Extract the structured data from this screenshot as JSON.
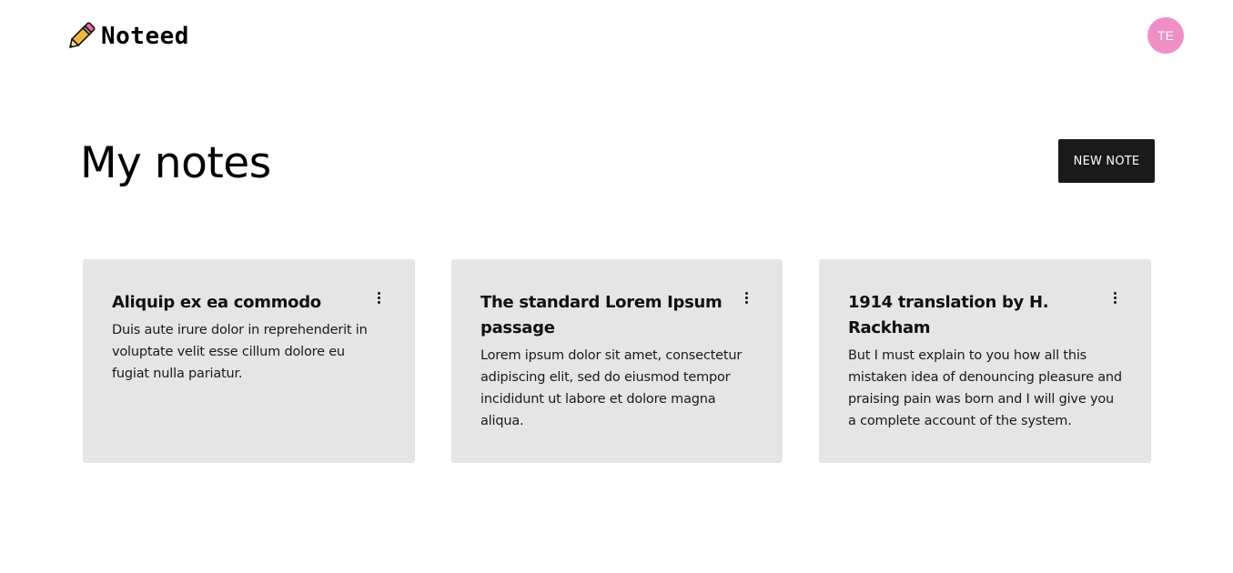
{
  "app": {
    "brand_name": "Noteed",
    "brand_icon": "pencil-icon"
  },
  "user": {
    "initials": "TE",
    "avatar_color": "#f08fc6"
  },
  "main": {
    "title": "My notes",
    "new_note_label": "NEW NOTE"
  },
  "notes": [
    {
      "title": "Aliquip ex ea commodo",
      "body": "Duis aute irure dolor in reprehenderit in voluptate velit esse cillum dolore eu fugiat nulla pariatur.",
      "menu_icon": "more-vertical-icon"
    },
    {
      "title": "The standard Lorem Ipsum passage",
      "body": "Lorem ipsum dolor sit amet, consectetur adipiscing elit, sed do eiusmod tempor incididunt ut labore et dolore magna aliqua.",
      "menu_icon": "more-vertical-icon"
    },
    {
      "title": "1914 translation by H. Rackham",
      "body": "But I must explain to you how all this mistaken idea of denouncing pleasure and praising pain was born and I will give you a complete account of the system.",
      "menu_icon": "more-vertical-icon"
    }
  ],
  "colors": {
    "card_background": "#e5e5e5",
    "button_background": "#1a1a1a",
    "pencil_body": "#f5b73b",
    "pencil_eraser": "#e96a9a"
  }
}
